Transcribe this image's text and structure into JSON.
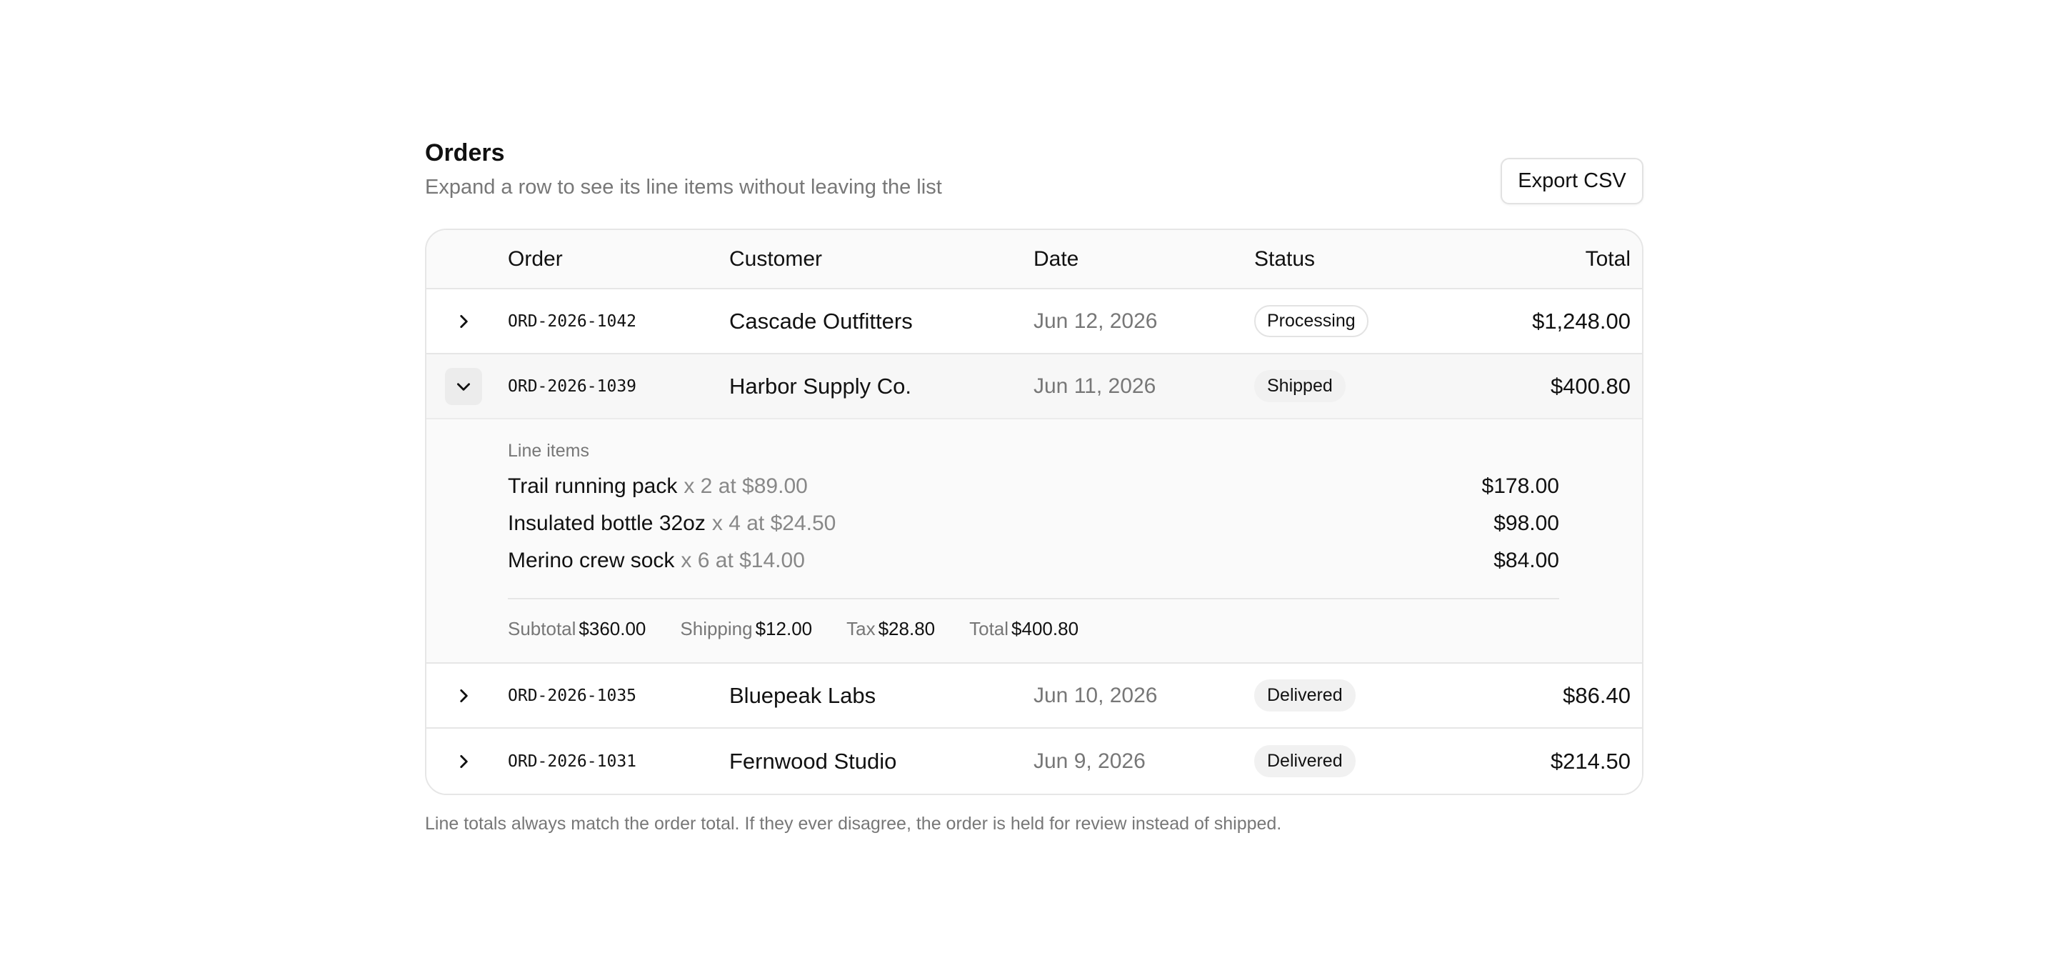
{
  "page": {
    "title": "Orders",
    "subtitle": "Expand a row to see its line items without leaving the list",
    "export_label": "Export CSV",
    "footnote": "Line totals always match the order total. If they ever disagree, the order is held for review instead of shipped."
  },
  "table": {
    "headers": {
      "order": "Order",
      "customer": "Customer",
      "date": "Date",
      "status": "Status",
      "total": "Total"
    },
    "rows": [
      {
        "id": "ORD-2026-1042",
        "customer": "Cascade Outfitters",
        "date": "Jun 12, 2026",
        "status": "Processing",
        "total": "$1,248.00",
        "expanded": false
      },
      {
        "id": "ORD-2026-1039",
        "customer": "Harbor Supply Co.",
        "date": "Jun 11, 2026",
        "status": "Shipped",
        "total": "$400.80",
        "expanded": true
      },
      {
        "id": "ORD-2026-1035",
        "customer": "Bluepeak Labs",
        "date": "Jun 10, 2026",
        "status": "Delivered",
        "total": "$86.40",
        "expanded": false
      },
      {
        "id": "ORD-2026-1031",
        "customer": "Fernwood Studio",
        "date": "Jun 9, 2026",
        "status": "Delivered",
        "total": "$214.50",
        "expanded": false
      }
    ],
    "detail": {
      "heading": "Line items",
      "items": [
        {
          "name": "Trail running pack",
          "qty": "x 2 at $89.00",
          "amount": "$178.00"
        },
        {
          "name": "Insulated bottle 32oz",
          "qty": "x 4 at $24.50",
          "amount": "$98.00"
        },
        {
          "name": "Merino crew sock",
          "qty": "x 6 at $14.00",
          "amount": "$84.00"
        }
      ],
      "summary": {
        "subtotal_label": "Subtotal",
        "subtotal": "$360.00",
        "shipping_label": "Shipping",
        "shipping": "$12.00",
        "tax_label": "Tax",
        "tax": "$28.80",
        "total_label": "Total",
        "total": "$400.80"
      }
    }
  },
  "colors": {
    "muted_text": "#777777",
    "border": "#e6e6e6",
    "badge_bg": "#f1f1f1"
  },
  "icons": {
    "collapsed": "chevron-right-icon",
    "expanded": "chevron-down-icon"
  }
}
